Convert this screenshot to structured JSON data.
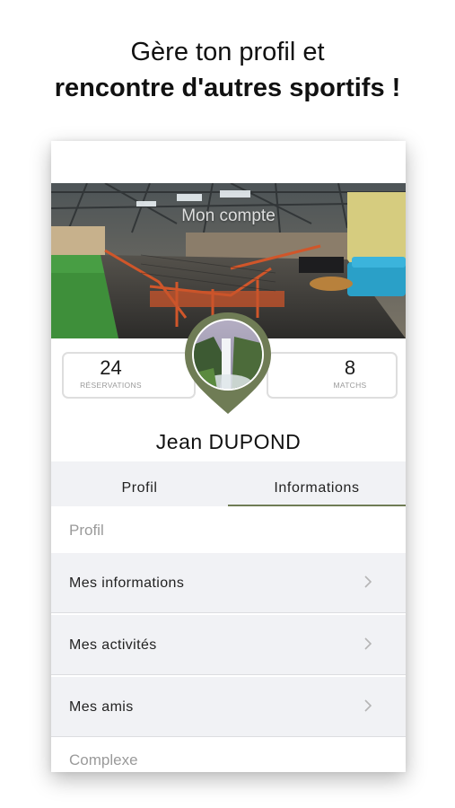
{
  "headline": {
    "line1": "Gère ton profil et",
    "line2": "rencontre d'autres sportifs !"
  },
  "account": {
    "title": "Mon compte",
    "reservations": {
      "value": "24",
      "label": "RÉSERVATIONS"
    },
    "matchs": {
      "value": "8",
      "label": "MATCHS"
    },
    "user_name": "Jean  DUPOND"
  },
  "tabs": [
    {
      "label": "Profil",
      "active": false
    },
    {
      "label": "Informations",
      "active": true
    }
  ],
  "sections": [
    {
      "title": "Profil",
      "items": [
        {
          "label": "Mes informations",
          "icon": "chevron-right-icon"
        },
        {
          "label": "Mes activités",
          "icon": "chevron-right-icon"
        },
        {
          "label": "Mes amis",
          "icon": "chevron-right-icon"
        }
      ]
    },
    {
      "title": "Complexe",
      "items": []
    }
  ],
  "colors": {
    "accent": "#6f7c55",
    "row_background": "#f1f2f5",
    "muted_text": "#9a9a9a"
  }
}
